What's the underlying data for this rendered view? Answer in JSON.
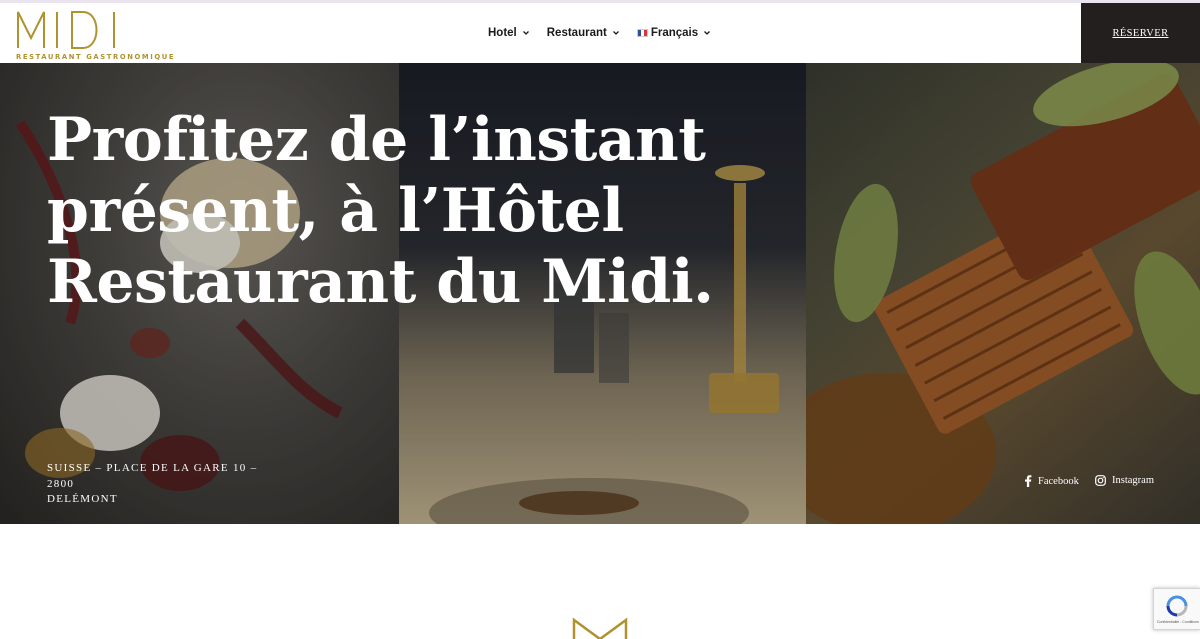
{
  "logo": {
    "letters": "MIDI",
    "subtitle": "RESTAURANT GASTRONOMIQUE"
  },
  "nav": {
    "items": [
      {
        "label": "Hotel"
      },
      {
        "label": "Restaurant"
      },
      {
        "label": "Français"
      }
    ]
  },
  "reserve": {
    "label": "RÉSERVER"
  },
  "hero": {
    "title_lines": [
      "Profitez de l’instant",
      "présent, à l’Hôtel",
      "Restaurant du Midi."
    ],
    "address_lines": [
      "SUISSE – PLACE DE LA GARE 10 – 2800",
      "DELÉMONT"
    ]
  },
  "social": {
    "facebook": "Facebook",
    "instagram": "Instagram"
  },
  "recaptcha": {
    "text": "Confidentialité - Conditions"
  },
  "colors": {
    "gold": "#b0922f",
    "dark": "#231f1e",
    "white": "#ffffff"
  }
}
